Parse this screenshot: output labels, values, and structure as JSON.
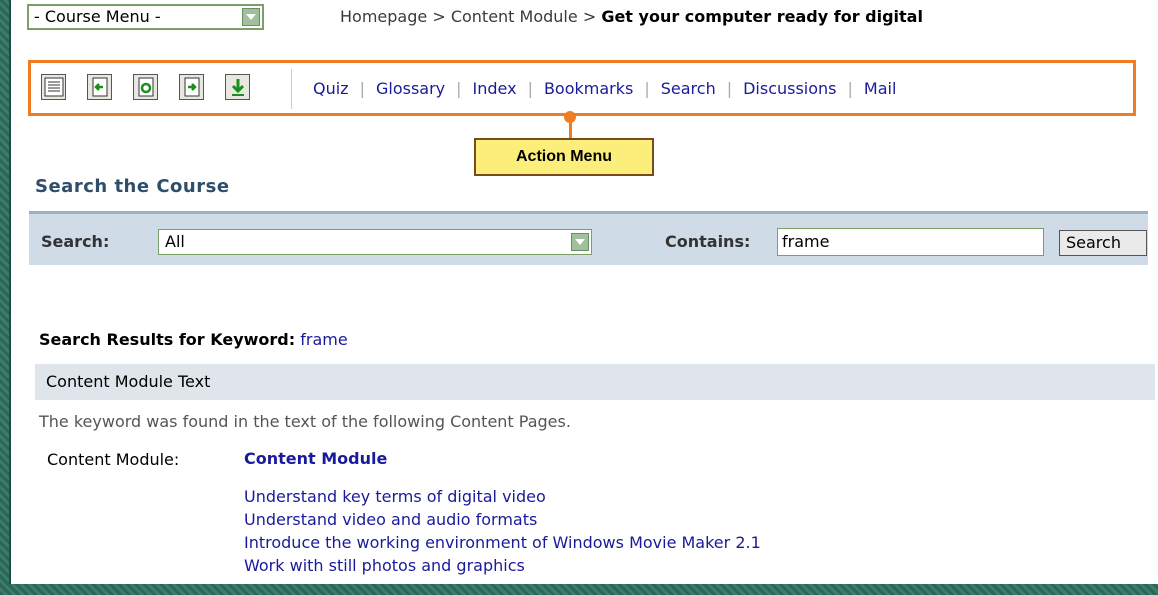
{
  "top": {
    "course_menu": "- Course Menu -",
    "breadcrumb_home": "Homepage",
    "breadcrumb_sep": ">",
    "breadcrumb_module": "Content Module",
    "breadcrumb_current": "Get your computer ready for digital"
  },
  "toolbar": {
    "icons": [
      "list-icon",
      "page-back-icon",
      "page-refresh-icon",
      "page-forward-icon",
      "download-icon"
    ],
    "links": [
      "Quiz",
      "Glossary",
      "Index",
      "Bookmarks",
      "Search",
      "Discussions",
      "Mail"
    ],
    "accent": "#f07d24"
  },
  "callout": {
    "label": "Action Menu"
  },
  "search": {
    "section_title": "Search the Course",
    "search_label": "Search:",
    "search_value": "All",
    "contains_label": "Contains:",
    "contains_value": "frame",
    "button_label": "Search"
  },
  "results": {
    "heading_prefix": "Search Results for Keyword:",
    "keyword": "frame",
    "band_label": "Content Module Text",
    "note": "The keyword was found in the text of the following Content Pages.",
    "module_label": "Content Module:",
    "module_link": "Content Module",
    "pages": [
      "Understand key terms of digital video",
      "Understand video and audio formats",
      "Introduce the working environment of Windows Movie Maker 2.1",
      "Work with still photos and graphics"
    ]
  }
}
